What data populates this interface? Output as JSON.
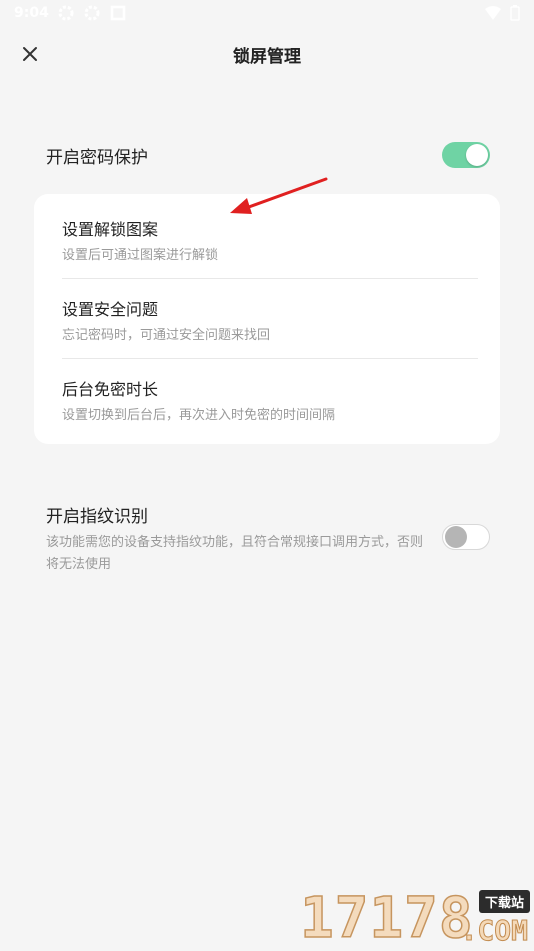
{
  "status_bar": {
    "time": "9:04",
    "left_icons": [
      "settings-gear-icon",
      "settings-gear-icon",
      "notification-icon"
    ],
    "right_icons": [
      "wifi-icon",
      "battery-icon"
    ]
  },
  "header": {
    "title": "锁屏管理"
  },
  "password_protection": {
    "title": "开启密码保护",
    "enabled": true
  },
  "settings_card": {
    "items": [
      {
        "title": "设置解锁图案",
        "description": "设置后可通过图案进行解锁"
      },
      {
        "title": "设置安全问题",
        "description": "忘记密码时，可通过安全问题来找回"
      },
      {
        "title": "后台免密时长",
        "description": "设置切换到后台后，再次进入时免密的时间间隔"
      }
    ]
  },
  "fingerprint": {
    "title": "开启指纹识别",
    "description": "该功能需您的设备支持指纹功能，且符合常规接口调用方式，否则将无法使用",
    "enabled": false
  },
  "watermark": {
    "digits": "17178",
    "tag": "下载站",
    "domain": ".COM"
  },
  "colors": {
    "toggle_on": "#6fd3a4",
    "toggle_off_knob": "#b5b5b5",
    "annotation_arrow": "#e02020",
    "background": "#f5f5f5"
  }
}
